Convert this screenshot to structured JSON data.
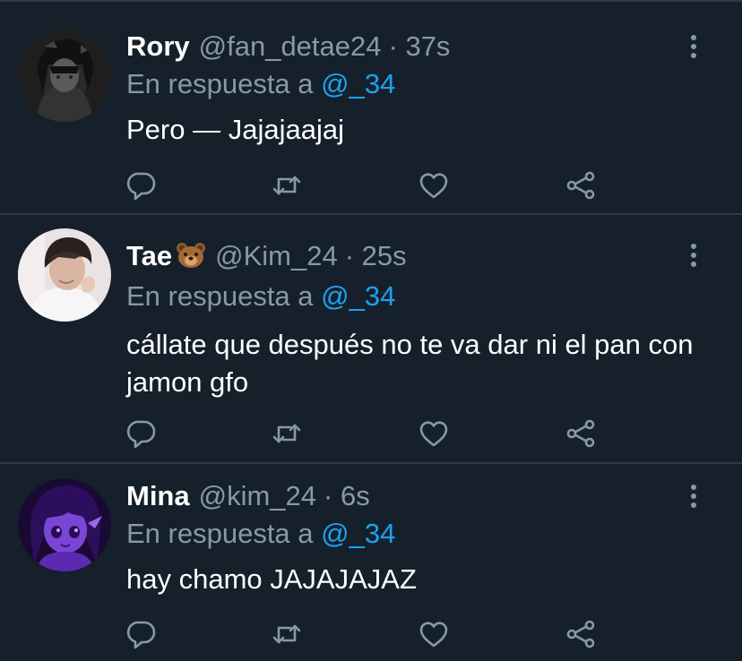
{
  "reply_prefix": "En respuesta a",
  "icons": {
    "reply": "reply-icon",
    "retweet": "retweet-icon",
    "like": "heart-icon",
    "share": "share-icon",
    "more": "more-vertical-icon"
  },
  "colors": {
    "background": "#15202b",
    "secondary_text": "#8899a6",
    "link": "#1da1f2",
    "divider": "#2f3a45"
  },
  "tweets": [
    {
      "name": "Rory",
      "handle": "@fan_detae24",
      "time": "· 37s",
      "reply_to": "@_34",
      "text": "Pero — Jajajaajaj"
    },
    {
      "name": "Tae",
      "name_emoji": "bear-emoji",
      "handle": "@Kim_24",
      "time": "· 25s",
      "reply_to": "@_34",
      "text": "cállate que después no te va dar ni el pan con jamon gfo"
    },
    {
      "name": "Mina",
      "handle": "@kim_24",
      "time": "· 6s",
      "reply_to": "@_34",
      "text": "hay chamo JAJAJAJAZ"
    }
  ]
}
